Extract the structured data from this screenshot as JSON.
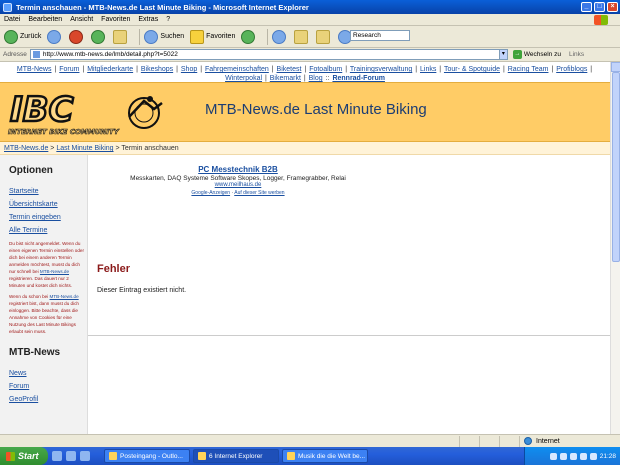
{
  "window": {
    "title": "Termin anschauen - MTB-News.de Last Minute Biking - Microsoft Internet Explorer",
    "buttons": {
      "minimize": "_",
      "maximize": "□",
      "close": "×"
    }
  },
  "menu": [
    "Datei",
    "Bearbeiten",
    "Ansicht",
    "Favoriten",
    "Extras",
    "?"
  ],
  "toolbar": {
    "back": "Zurück",
    "search": "Suchen",
    "favorites": "Favoriten",
    "research": "Research"
  },
  "address": {
    "label": "Adresse",
    "url": "http://www.mtb-news.de/lmb/detail.php?t=5022",
    "go": "Wechseln zu",
    "links": "Links"
  },
  "nav": {
    "links": [
      "MTB-News",
      "Forum",
      "Mitgliederkarte",
      "Bikeshops",
      "Shop",
      "Fahrgemeinschaften",
      "Biketest",
      "Fotoalbum",
      "Trainingsverwaltung",
      "Links",
      "Tour- & Spotguide",
      "Racing Team",
      "Profiblogs",
      "Winterpokal",
      "Bikemarkt",
      "Blog"
    ],
    "highlight": "Rennrad-Forum"
  },
  "banner": {
    "logo_text": "IBC",
    "logo_sub": "INTERNET BIKE COMMUNITY",
    "title": "MTB-News.de Last Minute Biking"
  },
  "breadcrumb": {
    "home": "MTB-News.de",
    "section": "Last Minute Biking",
    "current": "Termin anschauen",
    "sep": ">"
  },
  "sidebar": {
    "heading": "Optionen",
    "links": [
      "Startseite",
      "Übersichtskarte",
      "Termin eingeben",
      "Alle Termine"
    ],
    "note1_a": "Du bist nicht angemeldet. Wenn du einen eigenen Termin einstellen oder dich bei einem anderen Termin anmelden möchtest, musst du dich nur schnell bei ",
    "note1_link": "MTB-News.de",
    "note1_b": " registrieren. Das dauert nur 2 Minuten und kostet dich nichts.",
    "note2_a": "Wenn du schon bei ",
    "note2_link": "MTB-News.de",
    "note2_b": " registriert bist, dann musst du dich einloggen. Bitte beachte, dass die Annahme von Cookies für eine Nutzung des Last Minute Bikings erlaubt sein muss.",
    "heading2": "MTB-News",
    "links2": [
      "News",
      "Forum",
      "GeoProfil"
    ]
  },
  "ad": {
    "title": "PC Messtechnik B2B",
    "text": "Messkarten, DAQ Systeme Software Skopes, Logger, Framegrabber, Relai",
    "url": "www.meilhaus.de",
    "google": "Google-Anzeigen",
    "sep": "·",
    "advertise": "Auf dieser Site werben"
  },
  "error": {
    "heading": "Fehler",
    "message": "Dieser Eintrag existiert nicht."
  },
  "statusbar": {
    "zone": "Internet"
  },
  "taskbar": {
    "start": "Start",
    "tasks": [
      "Posteingang - Outlo...",
      "6 Internet Explorer",
      "Musik die die Welt be..."
    ],
    "clock": "21:28"
  }
}
